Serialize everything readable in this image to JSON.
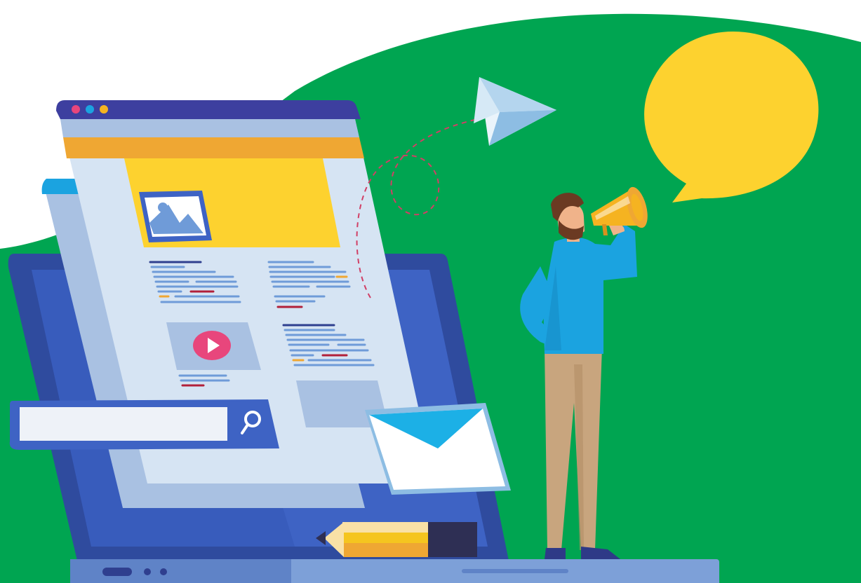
{
  "colors": {
    "background_green": "#00A551",
    "window_titlebar": "#3D3F9F",
    "window_body": "#D6E4F3",
    "orange_bar": "#EFA733",
    "yellow_banner": "#FDD22F",
    "speech_bubble": "#FDD22F",
    "laptop_frame": "#2F4B9E",
    "laptop_screen": "#3E63C4",
    "search_button": "#3E63C4",
    "person_shirt": "#1BA3E0",
    "person_pants": "#C8A57E",
    "megaphone": "#F5B321",
    "envelope_flap": "#1CB0E6",
    "play_button": "#E8467C"
  },
  "window_dots": [
    "#E8467C",
    "#1BA3E0",
    "#F5B321"
  ],
  "icons": {
    "search": "search-icon",
    "image": "image-icon",
    "play": "play-icon",
    "mail": "envelope-icon",
    "plane": "paper-plane-icon",
    "megaphone": "megaphone-icon",
    "pencil": "pencil-icon"
  },
  "search": {
    "value": "",
    "placeholder": ""
  }
}
